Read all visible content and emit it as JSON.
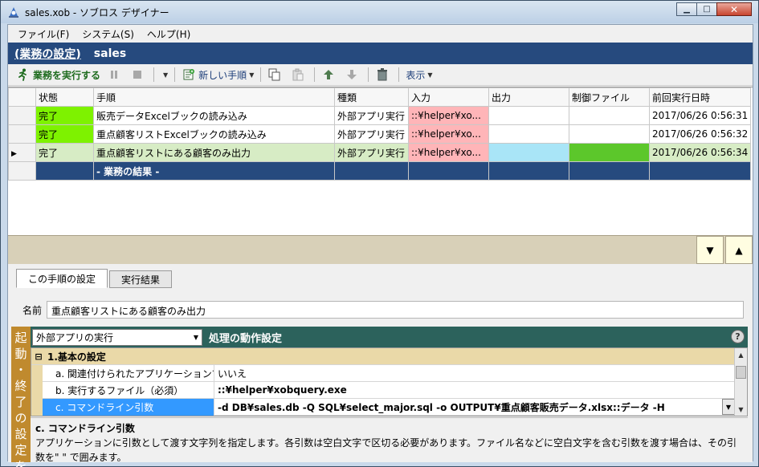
{
  "window": {
    "title": "sales.xob - ソブロス デザイナー",
    "minimize": "▁",
    "maximize": "□",
    "close": "✕"
  },
  "menu": [
    {
      "label": "ファイル(F)"
    },
    {
      "label": "システム(S)"
    },
    {
      "label": "ヘルプ(H)"
    }
  ],
  "header": {
    "link": "(業務の設定)",
    "name": "sales"
  },
  "toolbar": {
    "run": "業務を実行する",
    "new_step": "新しい手順",
    "view": "表示"
  },
  "grid": {
    "columns": [
      "状態",
      "手順",
      "種類",
      "入力",
      "出力",
      "制御ファイル",
      "前回実行日時"
    ],
    "rows": [
      {
        "status": "完了",
        "step": "販売データExcelブックの読み込み",
        "kind": "外部アプリ実行",
        "input": "::¥helper¥xo...",
        "output": "",
        "control": "",
        "last_run": "2017/06/26 0:56:31"
      },
      {
        "status": "完了",
        "step": "重点顧客リストExcelブックの読み込み",
        "kind": "外部アプリ実行",
        "input": "::¥helper¥xo...",
        "output": "",
        "control": "",
        "last_run": "2017/06/26 0:56:32"
      },
      {
        "status": "完了",
        "step": "重点顧客リストにある顧客のみ出力",
        "kind": "外部アプリ実行",
        "input": "::¥helper¥xo...",
        "output": "",
        "control": "",
        "last_run": "2017/06/26 0:56:34"
      }
    ],
    "result_row": "- 業務の結果 -",
    "selected_row": 2
  },
  "panel_buttons": {
    "down": "▼",
    "up": "▲"
  },
  "tabs": [
    {
      "label": "この手順の設定",
      "active": true
    },
    {
      "label": "実行結果",
      "active": false
    }
  ],
  "name_field": {
    "label": "名前",
    "value": "重点顧客リストにある顧客のみ出力"
  },
  "side_label": [
    "起",
    "動",
    "・",
    "終",
    "了",
    "の",
    "設",
    "定",
    "を"
  ],
  "props": {
    "type_select": "外部アプリの実行",
    "title": "処理の動作設定",
    "help": "?",
    "category": "1.基本の設定",
    "items": [
      {
        "name": "a. 関連付けられたアプリケーションで開く",
        "value": "いいえ",
        "bold": false
      },
      {
        "name": "b. 実行するファイル（必須）",
        "value": "::¥helper¥xobquery.exe",
        "bold": true
      },
      {
        "name": "c. コマンドライン引数",
        "value": "-d DB¥sales.db -Q SQL¥select_major.sql -o OUTPUT¥重点顧客販売データ.xlsx::データ -H",
        "bold": true
      }
    ]
  },
  "description": {
    "title": "c. コマンドライン引数",
    "text": "アプリケーションに引数として渡す文字列を指定します。各引数は空白文字で区切る必要があります。ファイル名などに空白文字を含む引数を渡す場合は、その引数を\" \" で囲みます。"
  },
  "colors": {
    "header_blue": "#264a7e",
    "status_done": "#7ef200",
    "input_cell": "#ffb5b8",
    "output_selected": "#a9e5f7",
    "control_selected": "#5cc72b",
    "prop_header": "#2c625c",
    "side_bar": "#c08a2e"
  }
}
